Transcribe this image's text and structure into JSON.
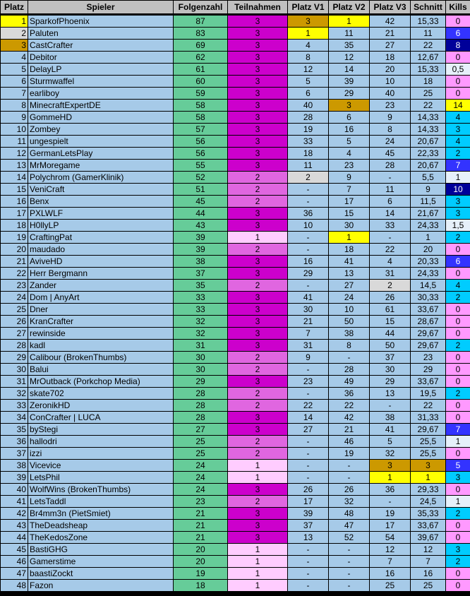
{
  "headers": [
    "Platz",
    "Spieler",
    "Folgenzahl",
    "Teilnahmen",
    "Platz V1",
    "Platz V2",
    "Platz V3",
    "Schnitt",
    "Kills"
  ],
  "colors": {
    "gold": "#ffff00",
    "silver": "#d9d9d9",
    "bronze": "#cc9900",
    "part3": "#cc00cc",
    "part2": "#e066e0",
    "part1": "#ffccff",
    "kills0": "#ff99ff",
    "kills_low": "#e6f0fa",
    "kills_mid": "#00ccff",
    "kills_high": "#3333ff",
    "kills_top": "#000099"
  },
  "rows": [
    {
      "rank": "1",
      "name": "SparkofPhoenix",
      "eps": "87",
      "part": "3",
      "v1": "3",
      "v2": "1",
      "v3": "42",
      "avg": "15,33",
      "kills": "0",
      "rankColor": "gold",
      "partColor": "part3",
      "v1Color": "bronze",
      "v2Color": "gold",
      "v3Color": "",
      "killsColor": "kills0"
    },
    {
      "rank": "2",
      "name": "Paluten",
      "eps": "83",
      "part": "3",
      "v1": "1",
      "v2": "11",
      "v3": "21",
      "avg": "11",
      "kills": "6",
      "rankColor": "silver",
      "partColor": "part3",
      "v1Color": "gold",
      "v2Color": "",
      "v3Color": "",
      "killsColor": "kills_high"
    },
    {
      "rank": "3",
      "name": "CastCrafter",
      "eps": "69",
      "part": "3",
      "v1": "4",
      "v2": "35",
      "v3": "27",
      "avg": "22",
      "kills": "8",
      "rankColor": "bronze",
      "partColor": "part3",
      "v1Color": "",
      "v2Color": "",
      "v3Color": "",
      "killsColor": "kills_top"
    },
    {
      "rank": "4",
      "name": "Debitor",
      "eps": "62",
      "part": "3",
      "v1": "8",
      "v2": "12",
      "v3": "18",
      "avg": "12,67",
      "kills": "0",
      "rankColor": "",
      "partColor": "part3",
      "v1Color": "",
      "v2Color": "",
      "v3Color": "",
      "killsColor": "kills0"
    },
    {
      "rank": "5",
      "name": "DelayLP",
      "eps": "61",
      "part": "3",
      "v1": "12",
      "v2": "14",
      "v3": "20",
      "avg": "15,33",
      "kills": "0,5",
      "rankColor": "",
      "partColor": "part3",
      "v1Color": "",
      "v2Color": "",
      "v3Color": "",
      "killsColor": "kills_low"
    },
    {
      "rank": "6",
      "name": "Sturmwaffel",
      "eps": "60",
      "part": "3",
      "v1": "5",
      "v2": "39",
      "v3": "10",
      "avg": "18",
      "kills": "0",
      "rankColor": "",
      "partColor": "part3",
      "v1Color": "",
      "v2Color": "",
      "v3Color": "",
      "killsColor": "kills0"
    },
    {
      "rank": "7",
      "name": "earliboy",
      "eps": "59",
      "part": "3",
      "v1": "6",
      "v2": "29",
      "v3": "40",
      "avg": "25",
      "kills": "0",
      "rankColor": "",
      "partColor": "part3",
      "v1Color": "",
      "v2Color": "",
      "v3Color": "",
      "killsColor": "kills0"
    },
    {
      "rank": "8",
      "name": "MinecraftExpertDE",
      "eps": "58",
      "part": "3",
      "v1": "40",
      "v2": "3",
      "v3": "23",
      "avg": "22",
      "kills": "14",
      "rankColor": "",
      "partColor": "part3",
      "v1Color": "",
      "v2Color": "bronze",
      "v3Color": "",
      "killsColor": "gold"
    },
    {
      "rank": "9",
      "name": "GommeHD",
      "eps": "58",
      "part": "3",
      "v1": "28",
      "v2": "6",
      "v3": "9",
      "avg": "14,33",
      "kills": "4",
      "rankColor": "",
      "partColor": "part3",
      "v1Color": "",
      "v2Color": "",
      "v3Color": "",
      "killsColor": "kills_mid"
    },
    {
      "rank": "10",
      "name": "Zombey",
      "eps": "57",
      "part": "3",
      "v1": "19",
      "v2": "16",
      "v3": "8",
      "avg": "14,33",
      "kills": "3",
      "rankColor": "",
      "partColor": "part3",
      "v1Color": "",
      "v2Color": "",
      "v3Color": "",
      "killsColor": "kills_mid"
    },
    {
      "rank": "11",
      "name": "ungespielt",
      "eps": "56",
      "part": "3",
      "v1": "33",
      "v2": "5",
      "v3": "24",
      "avg": "20,67",
      "kills": "4",
      "rankColor": "",
      "partColor": "part3",
      "v1Color": "",
      "v2Color": "",
      "v3Color": "",
      "killsColor": "kills_mid"
    },
    {
      "rank": "12",
      "name": "GermanLetsPlay",
      "eps": "56",
      "part": "3",
      "v1": "18",
      "v2": "4",
      "v3": "45",
      "avg": "22,33",
      "kills": "2",
      "rankColor": "",
      "partColor": "part3",
      "v1Color": "",
      "v2Color": "",
      "v3Color": "",
      "killsColor": "kills_mid"
    },
    {
      "rank": "13",
      "name": "MrMoregame",
      "eps": "55",
      "part": "3",
      "v1": "11",
      "v2": "23",
      "v3": "28",
      "avg": "20,67",
      "kills": "7",
      "rankColor": "",
      "partColor": "part3",
      "v1Color": "",
      "v2Color": "",
      "v3Color": "",
      "killsColor": "kills_high"
    },
    {
      "rank": "14",
      "name": "Polychrom (GamerKlinik)",
      "eps": "52",
      "part": "2",
      "v1": "2",
      "v2": "9",
      "v3": "-",
      "avg": "5,5",
      "kills": "1",
      "rankColor": "",
      "partColor": "part2",
      "v1Color": "silver",
      "v2Color": "",
      "v3Color": "",
      "killsColor": "kills_low"
    },
    {
      "rank": "15",
      "name": "VeniCraft",
      "eps": "51",
      "part": "2",
      "v1": "-",
      "v2": "7",
      "v3": "11",
      "avg": "9",
      "kills": "10",
      "rankColor": "",
      "partColor": "part2",
      "v1Color": "",
      "v2Color": "",
      "v3Color": "",
      "killsColor": "kills_top"
    },
    {
      "rank": "16",
      "name": "Benx",
      "eps": "45",
      "part": "2",
      "v1": "-",
      "v2": "17",
      "v3": "6",
      "avg": "11,5",
      "kills": "3",
      "rankColor": "",
      "partColor": "part2",
      "v1Color": "",
      "v2Color": "",
      "v3Color": "",
      "killsColor": "kills_mid"
    },
    {
      "rank": "17",
      "name": "PXLWLF",
      "eps": "44",
      "part": "3",
      "v1": "36",
      "v2": "15",
      "v3": "14",
      "avg": "21,67",
      "kills": "3",
      "rankColor": "",
      "partColor": "part3",
      "v1Color": "",
      "v2Color": "",
      "v3Color": "",
      "killsColor": "kills_mid"
    },
    {
      "rank": "18",
      "name": "H0llyLP",
      "eps": "43",
      "part": "3",
      "v1": "10",
      "v2": "30",
      "v3": "33",
      "avg": "24,33",
      "kills": "1,5",
      "rankColor": "",
      "partColor": "part3",
      "v1Color": "",
      "v2Color": "",
      "v3Color": "",
      "killsColor": "kills_low"
    },
    {
      "rank": "19",
      "name": "CraftingPat",
      "eps": "39",
      "part": "1",
      "v1": "-",
      "v2": "1",
      "v3": "-",
      "avg": "1",
      "kills": "2",
      "rankColor": "",
      "partColor": "part1",
      "v1Color": "",
      "v2Color": "gold",
      "v3Color": "",
      "killsColor": "kills_mid"
    },
    {
      "rank": "20",
      "name": "maudado",
      "eps": "39",
      "part": "2",
      "v1": "-",
      "v2": "18",
      "v3": "22",
      "avg": "20",
      "kills": "0",
      "rankColor": "",
      "partColor": "part2",
      "v1Color": "",
      "v2Color": "",
      "v3Color": "",
      "killsColor": "kills0"
    },
    {
      "rank": "21",
      "name": "AviveHD",
      "eps": "38",
      "part": "3",
      "v1": "16",
      "v2": "41",
      "v3": "4",
      "avg": "20,33",
      "kills": "6",
      "rankColor": "",
      "partColor": "part3",
      "v1Color": "",
      "v2Color": "",
      "v3Color": "",
      "killsColor": "kills_high"
    },
    {
      "rank": "22",
      "name": "Herr Bergmann",
      "eps": "37",
      "part": "3",
      "v1": "29",
      "v2": "13",
      "v3": "31",
      "avg": "24,33",
      "kills": "0",
      "rankColor": "",
      "partColor": "part3",
      "v1Color": "",
      "v2Color": "",
      "v3Color": "",
      "killsColor": "kills0"
    },
    {
      "rank": "23",
      "name": "Zander",
      "eps": "35",
      "part": "2",
      "v1": "-",
      "v2": "27",
      "v3": "2",
      "avg": "14,5",
      "kills": "4",
      "rankColor": "",
      "partColor": "part2",
      "v1Color": "",
      "v2Color": "",
      "v3Color": "silver",
      "killsColor": "kills_mid"
    },
    {
      "rank": "24",
      "name": "Dom | AnyArt",
      "eps": "33",
      "part": "3",
      "v1": "41",
      "v2": "24",
      "v3": "26",
      "avg": "30,33",
      "kills": "2",
      "rankColor": "",
      "partColor": "part3",
      "v1Color": "",
      "v2Color": "",
      "v3Color": "",
      "killsColor": "kills_mid"
    },
    {
      "rank": "25",
      "name": "Dner",
      "eps": "33",
      "part": "3",
      "v1": "30",
      "v2": "10",
      "v3": "61",
      "avg": "33,67",
      "kills": "0",
      "rankColor": "",
      "partColor": "part3",
      "v1Color": "",
      "v2Color": "",
      "v3Color": "",
      "killsColor": "kills0"
    },
    {
      "rank": "26",
      "name": "KranCrafter",
      "eps": "32",
      "part": "3",
      "v1": "21",
      "v2": "50",
      "v3": "15",
      "avg": "28,67",
      "kills": "0",
      "rankColor": "",
      "partColor": "part3",
      "v1Color": "",
      "v2Color": "",
      "v3Color": "",
      "killsColor": "kills0"
    },
    {
      "rank": "27",
      "name": "rewinside",
      "eps": "32",
      "part": "3",
      "v1": "7",
      "v2": "38",
      "v3": "44",
      "avg": "29,67",
      "kills": "0",
      "rankColor": "",
      "partColor": "part3",
      "v1Color": "",
      "v2Color": "",
      "v3Color": "",
      "killsColor": "kills0"
    },
    {
      "rank": "28",
      "name": "kadl",
      "eps": "31",
      "part": "3",
      "v1": "31",
      "v2": "8",
      "v3": "50",
      "avg": "29,67",
      "kills": "2",
      "rankColor": "",
      "partColor": "part3",
      "v1Color": "",
      "v2Color": "",
      "v3Color": "",
      "killsColor": "kills_mid"
    },
    {
      "rank": "29",
      "name": "Calibour (BrokenThumbs)",
      "eps": "30",
      "part": "2",
      "v1": "9",
      "v2": "-",
      "v3": "37",
      "avg": "23",
      "kills": "0",
      "rankColor": "",
      "partColor": "part2",
      "v1Color": "",
      "v2Color": "",
      "v3Color": "",
      "killsColor": "kills0"
    },
    {
      "rank": "30",
      "name": "Balui",
      "eps": "30",
      "part": "2",
      "v1": "-",
      "v2": "28",
      "v3": "30",
      "avg": "29",
      "kills": "0",
      "rankColor": "",
      "partColor": "part2",
      "v1Color": "",
      "v2Color": "",
      "v3Color": "",
      "killsColor": "kills0"
    },
    {
      "rank": "31",
      "name": "MrOutback (Porkchop Media)",
      "eps": "29",
      "part": "3",
      "v1": "23",
      "v2": "49",
      "v3": "29",
      "avg": "33,67",
      "kills": "0",
      "rankColor": "",
      "partColor": "part3",
      "v1Color": "",
      "v2Color": "",
      "v3Color": "",
      "killsColor": "kills0"
    },
    {
      "rank": "32",
      "name": "skate702",
      "eps": "28",
      "part": "2",
      "v1": "-",
      "v2": "36",
      "v3": "13",
      "avg": "19,5",
      "kills": "2",
      "rankColor": "",
      "partColor": "part2",
      "v1Color": "",
      "v2Color": "",
      "v3Color": "",
      "killsColor": "kills_mid"
    },
    {
      "rank": "33",
      "name": "ZeronikHD",
      "eps": "28",
      "part": "2",
      "v1": "22",
      "v2": "22",
      "v3": "-",
      "avg": "22",
      "kills": "0",
      "rankColor": "",
      "partColor": "part2",
      "v1Color": "",
      "v2Color": "",
      "v3Color": "",
      "killsColor": "kills0"
    },
    {
      "rank": "34",
      "name": "ConCrafter | LUCA",
      "eps": "28",
      "part": "3",
      "v1": "14",
      "v2": "42",
      "v3": "38",
      "avg": "31,33",
      "kills": "0",
      "rankColor": "",
      "partColor": "part3",
      "v1Color": "",
      "v2Color": "",
      "v3Color": "",
      "killsColor": "kills0"
    },
    {
      "rank": "35",
      "name": "byStegi",
      "eps": "27",
      "part": "3",
      "v1": "27",
      "v2": "21",
      "v3": "41",
      "avg": "29,67",
      "kills": "7",
      "rankColor": "",
      "partColor": "part3",
      "v1Color": "",
      "v2Color": "",
      "v3Color": "",
      "killsColor": "kills_high"
    },
    {
      "rank": "36",
      "name": "hallodri",
      "eps": "25",
      "part": "2",
      "v1": "-",
      "v2": "46",
      "v3": "5",
      "avg": "25,5",
      "kills": "1",
      "rankColor": "",
      "partColor": "part2",
      "v1Color": "",
      "v2Color": "",
      "v3Color": "",
      "killsColor": "kills_low"
    },
    {
      "rank": "37",
      "name": "izzi",
      "eps": "25",
      "part": "2",
      "v1": "-",
      "v2": "19",
      "v3": "32",
      "avg": "25,5",
      "kills": "0",
      "rankColor": "",
      "partColor": "part2",
      "v1Color": "",
      "v2Color": "",
      "v3Color": "",
      "killsColor": "kills0"
    },
    {
      "rank": "38",
      "name": "Vicevice",
      "eps": "24",
      "part": "1",
      "v1": "-",
      "v2": "-",
      "v3": "3",
      "avg": "3",
      "kills": "5",
      "rankColor": "",
      "partColor": "part1",
      "v1Color": "",
      "v2Color": "",
      "v3Color": "bronze",
      "avgColor": "bronze",
      "killsColor": "kills_high"
    },
    {
      "rank": "39",
      "name": "LetsPhil",
      "eps": "24",
      "part": "1",
      "v1": "-",
      "v2": "-",
      "v3": "1",
      "avg": "1",
      "kills": "3",
      "rankColor": "",
      "partColor": "part1",
      "v1Color": "",
      "v2Color": "",
      "v3Color": "gold",
      "avgColor": "gold",
      "killsColor": "kills_mid"
    },
    {
      "rank": "40",
      "name": "WolfWins (BrokenThumbs)",
      "eps": "24",
      "part": "3",
      "v1": "26",
      "v2": "26",
      "v3": "36",
      "avg": "29,33",
      "kills": "0",
      "rankColor": "",
      "partColor": "part3",
      "v1Color": "",
      "v2Color": "",
      "v3Color": "",
      "killsColor": "kills0"
    },
    {
      "rank": "41",
      "name": "LetsTaddl",
      "eps": "23",
      "part": "2",
      "v1": "17",
      "v2": "32",
      "v3": "-",
      "avg": "24,5",
      "kills": "1",
      "rankColor": "",
      "partColor": "part2",
      "v1Color": "",
      "v2Color": "",
      "v3Color": "",
      "killsColor": "kills_low"
    },
    {
      "rank": "42",
      "name": "Br4mm3n (PietSmiet)",
      "eps": "21",
      "part": "3",
      "v1": "39",
      "v2": "48",
      "v3": "19",
      "avg": "35,33",
      "kills": "2",
      "rankColor": "",
      "partColor": "part3",
      "v1Color": "",
      "v2Color": "",
      "v3Color": "",
      "killsColor": "kills_mid"
    },
    {
      "rank": "43",
      "name": "TheDeadsheap",
      "eps": "21",
      "part": "3",
      "v1": "37",
      "v2": "47",
      "v3": "17",
      "avg": "33,67",
      "kills": "0",
      "rankColor": "",
      "partColor": "part3",
      "v1Color": "",
      "v2Color": "",
      "v3Color": "",
      "killsColor": "kills0"
    },
    {
      "rank": "44",
      "name": "TheKedosZone",
      "eps": "21",
      "part": "3",
      "v1": "13",
      "v2": "52",
      "v3": "54",
      "avg": "39,67",
      "kills": "0",
      "rankColor": "",
      "partColor": "part3",
      "v1Color": "",
      "v2Color": "",
      "v3Color": "",
      "killsColor": "kills0"
    },
    {
      "rank": "45",
      "name": "BastiGHG",
      "eps": "20",
      "part": "1",
      "v1": "-",
      "v2": "-",
      "v3": "12",
      "avg": "12",
      "kills": "3",
      "rankColor": "",
      "partColor": "part1",
      "v1Color": "",
      "v2Color": "",
      "v3Color": "",
      "killsColor": "kills_mid"
    },
    {
      "rank": "46",
      "name": "Gamerstime",
      "eps": "20",
      "part": "1",
      "v1": "-",
      "v2": "-",
      "v3": "7",
      "avg": "7",
      "kills": "2",
      "rankColor": "",
      "partColor": "part1",
      "v1Color": "",
      "v2Color": "",
      "v3Color": "",
      "killsColor": "kills_mid"
    },
    {
      "rank": "47",
      "name": "baastiZockt",
      "eps": "19",
      "part": "1",
      "v1": "-",
      "v2": "-",
      "v3": "16",
      "avg": "16",
      "kills": "0",
      "rankColor": "",
      "partColor": "part1",
      "v1Color": "",
      "v2Color": "",
      "v3Color": "",
      "killsColor": "kills0"
    },
    {
      "rank": "48",
      "name": "Fazon",
      "eps": "18",
      "part": "1",
      "v1": "-",
      "v2": "-",
      "v3": "25",
      "avg": "25",
      "kills": "0",
      "rankColor": "",
      "partColor": "part1",
      "v1Color": "",
      "v2Color": "",
      "v3Color": "",
      "killsColor": "kills0"
    }
  ]
}
